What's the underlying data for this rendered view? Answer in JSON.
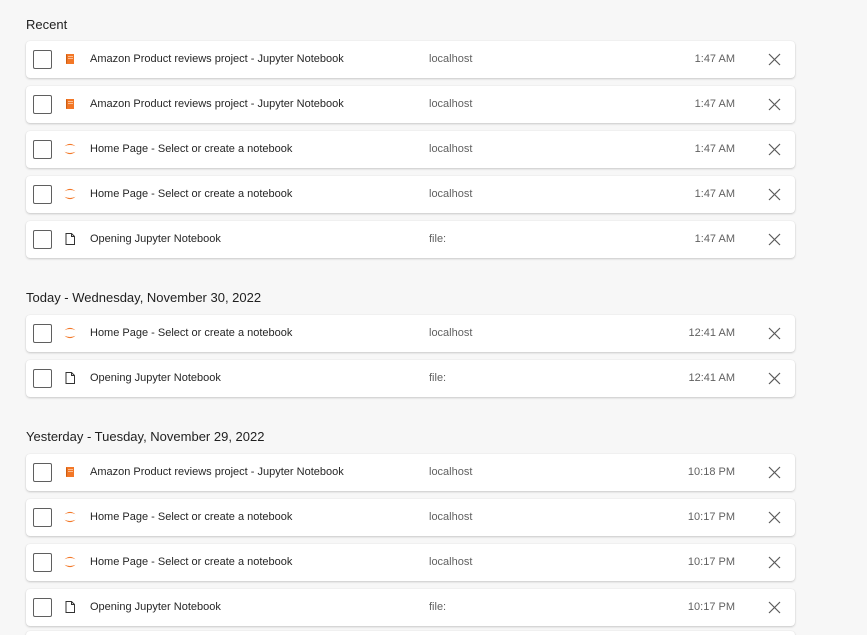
{
  "sections": [
    {
      "heading": "Recent",
      "items": [
        {
          "title": "Amazon Product reviews project - Jupyter Notebook",
          "domain": "localhost",
          "time": "1:47 AM",
          "icon": "notebook-icon"
        },
        {
          "title": "Amazon Product reviews project - Jupyter Notebook",
          "domain": "localhost",
          "time": "1:47 AM",
          "icon": "notebook-icon"
        },
        {
          "title": "Home Page - Select or create a notebook",
          "domain": "localhost",
          "time": "1:47 AM",
          "icon": "jupyter-icon"
        },
        {
          "title": "Home Page - Select or create a notebook",
          "domain": "localhost",
          "time": "1:47 AM",
          "icon": "jupyter-icon"
        },
        {
          "title": "Opening Jupyter Notebook",
          "domain": "file:",
          "time": "1:47 AM",
          "icon": "file-icon"
        }
      ]
    },
    {
      "heading": "Today - Wednesday, November 30, 2022",
      "items": [
        {
          "title": "Home Page - Select or create a notebook",
          "domain": "localhost",
          "time": "12:41 AM",
          "icon": "jupyter-icon"
        },
        {
          "title": "Opening Jupyter Notebook",
          "domain": "file:",
          "time": "12:41 AM",
          "icon": "file-icon"
        }
      ]
    },
    {
      "heading": "Yesterday - Tuesday, November 29, 2022",
      "items": [
        {
          "title": "Amazon Product reviews project - Jupyter Notebook",
          "domain": "localhost",
          "time": "10:18 PM",
          "icon": "notebook-icon"
        },
        {
          "title": "Home Page - Select or create a notebook",
          "domain": "localhost",
          "time": "10:17 PM",
          "icon": "jupyter-icon"
        },
        {
          "title": "Home Page - Select or create a notebook",
          "domain": "localhost",
          "time": "10:17 PM",
          "icon": "jupyter-icon"
        },
        {
          "title": "Opening Jupyter Notebook",
          "domain": "file:",
          "time": "10:17 PM",
          "icon": "file-icon"
        }
      ]
    }
  ],
  "colors": {
    "accent_orange": "#f37726",
    "background": "#f7f7f7"
  }
}
